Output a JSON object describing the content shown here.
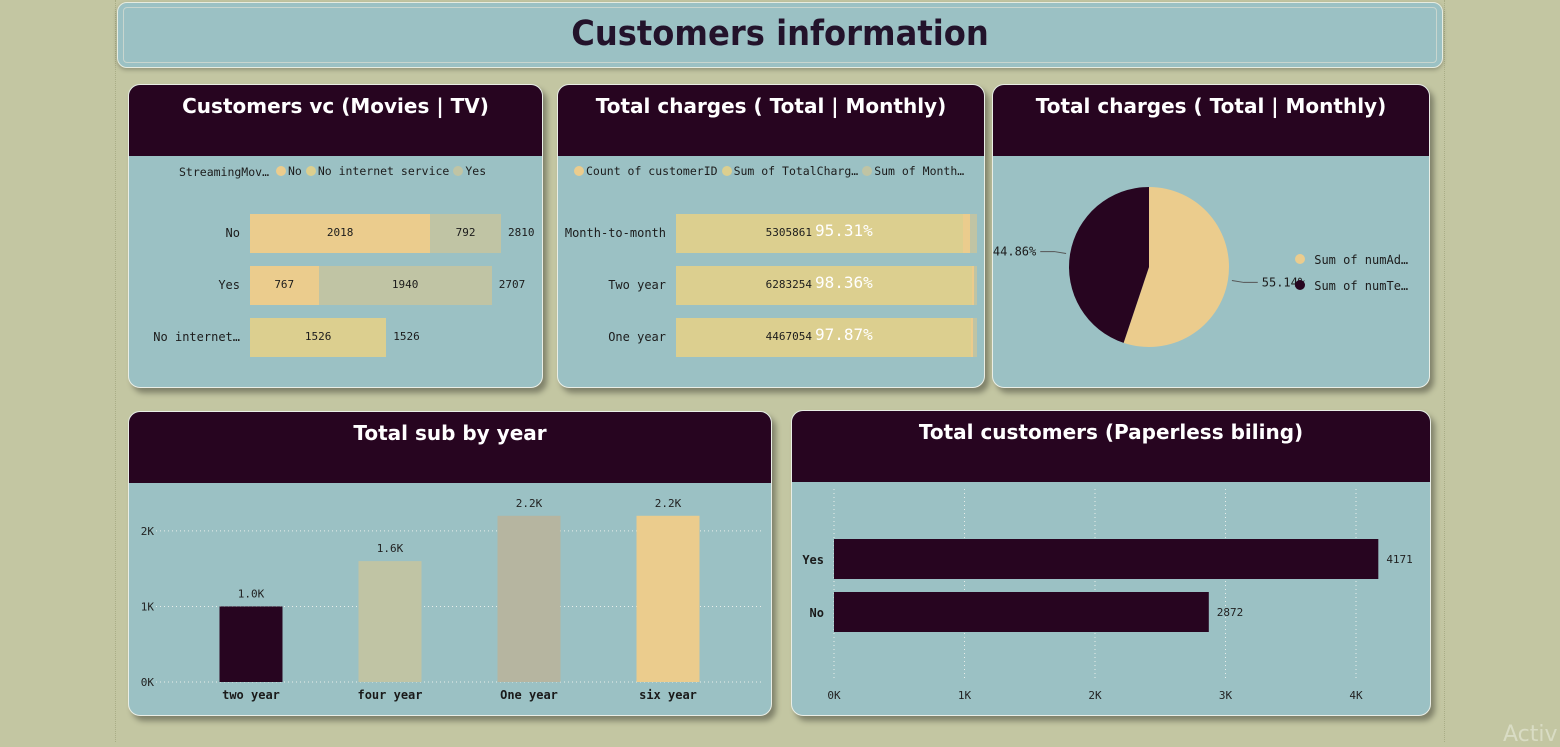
{
  "page": {
    "title": "Customers information",
    "watermark": "Activ"
  },
  "colors": {
    "dark": "#270520",
    "teal": "#9bc1c4",
    "sand": "#ebcc8d",
    "olive": "#c0c4a4",
    "grey": "#b6b5a0",
    "lightSand": "#dccf8f"
  },
  "card1": {
    "title": "Customers vc (Movies | TV)",
    "legend": {
      "label": "StreamingMov…",
      "items": [
        {
          "name": "No",
          "color": "#ebcc8d"
        },
        {
          "name": "No internet service",
          "color": "#dccf8f"
        },
        {
          "name": "Yes",
          "color": "#c0c4a4"
        }
      ]
    },
    "chart_data": {
      "type": "bar",
      "orientation": "horizontal",
      "stacked": true,
      "categories": [
        "No",
        "Yes",
        "No internet…"
      ],
      "series": [
        {
          "name": "No",
          "values": [
            2018,
            767,
            null
          ]
        },
        {
          "name": "No internet service",
          "values": [
            null,
            null,
            1526
          ]
        },
        {
          "name": "Yes",
          "values": [
            792,
            1940,
            null
          ]
        }
      ],
      "totals": [
        2810,
        2707,
        1526
      ]
    }
  },
  "card2": {
    "title": "Total charges ( Total | Monthly)",
    "legend": [
      "Count of customerID",
      "Sum of TotalCharg…",
      "Sum of Month…"
    ],
    "chart_data": {
      "type": "bar",
      "orientation": "horizontal",
      "stacked": true,
      "percent": true,
      "categories": [
        "Month-to-month",
        "Two year",
        "One year"
      ],
      "series": [
        {
          "name": "Sum of TotalCharg…",
          "values": [
            5305861,
            6283254,
            4467054
          ],
          "percent_labels": [
            "95.31%",
            "98.36%",
            "97.87%"
          ]
        },
        {
          "name": "Count of customerID",
          "percent": [
            0.025,
            0.006,
            0.008
          ]
        },
        {
          "name": "Sum of Month…",
          "percent": [
            0.022,
            0.01,
            0.013
          ]
        }
      ]
    }
  },
  "card3": {
    "title": "Total charges ( Total | Monthly)",
    "chart_data": {
      "type": "pie",
      "slices": [
        {
          "name": "Sum of numAd…",
          "value": 55.14,
          "label": "55.14%",
          "color": "#ebcc8d"
        },
        {
          "name": "Sum of numTe…",
          "value": 44.86,
          "label": "44.86%",
          "color": "#270520"
        }
      ]
    }
  },
  "card4": {
    "title": "Total sub by year",
    "chart_data": {
      "type": "bar",
      "categories": [
        "two year",
        "four year",
        "One year",
        "six year"
      ],
      "values": [
        1000,
        1600,
        2200,
        2200
      ],
      "value_labels": [
        "1.0K",
        "1.6K",
        "2.2K",
        "2.2K"
      ],
      "colors": [
        "#270520",
        "#c0c4a4",
        "#b6b5a0",
        "#ebcc8d"
      ],
      "yticks": [
        "0K",
        "1K",
        "2K"
      ],
      "ylim": [
        0,
        2250
      ],
      "grid": true
    }
  },
  "card5": {
    "title": "Total customers (Paperless biling)",
    "chart_data": {
      "type": "bar",
      "orientation": "horizontal",
      "categories": [
        "Yes",
        "No"
      ],
      "values": [
        4171,
        2872
      ],
      "value_labels": [
        "4171",
        "2872"
      ],
      "xticks": [
        "0K",
        "1K",
        "2K",
        "3K",
        "4K"
      ],
      "xlim": [
        0,
        4000
      ],
      "grid": true
    }
  }
}
